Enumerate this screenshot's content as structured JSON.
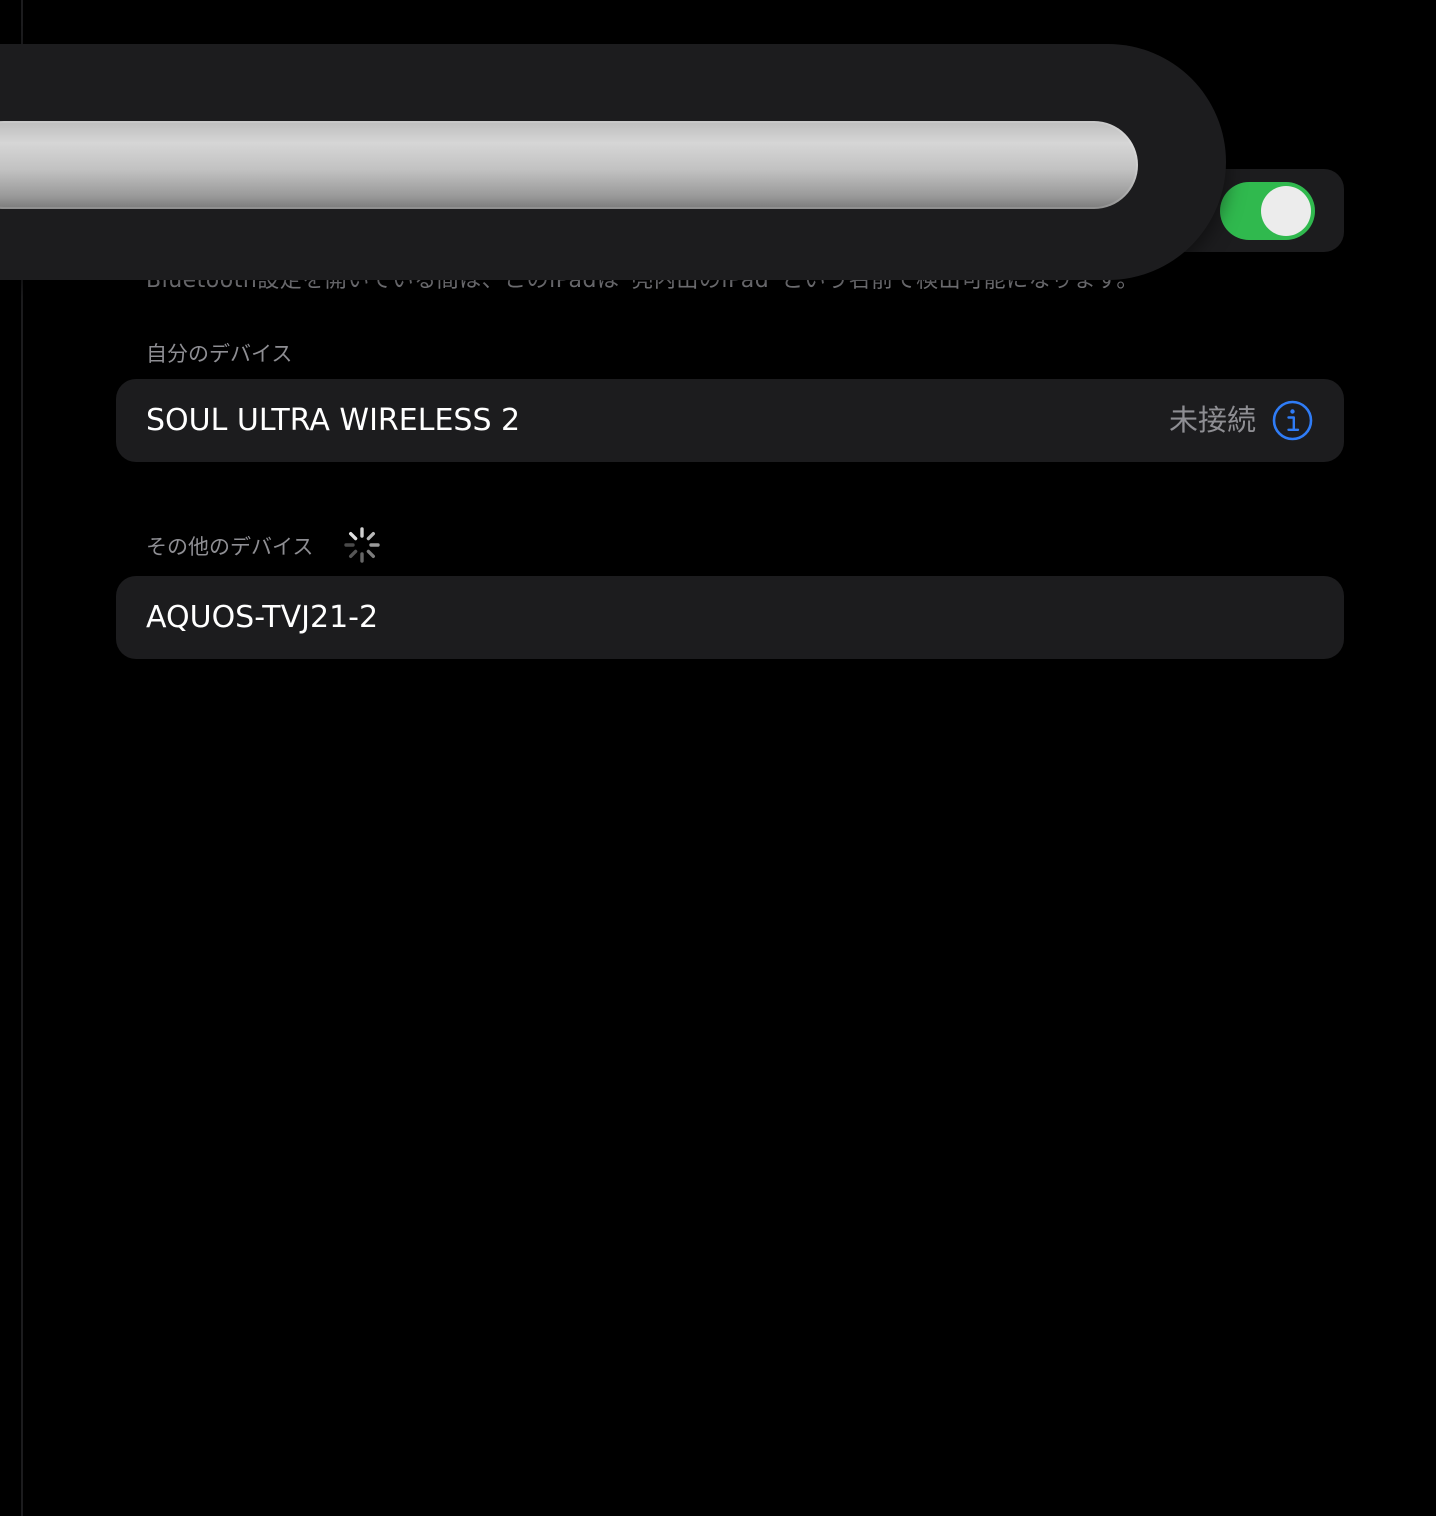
{
  "bluetooth": {
    "enabled": true,
    "footer_text": "Bluetooth設定を開いている間は、このiPadは“亮内出のiPad”という名前で検出可能になります。"
  },
  "my_devices": {
    "header": "自分のデバイス",
    "items": [
      {
        "name": "SOUL ULTRA WIRELESS 2",
        "status": "未接続"
      }
    ]
  },
  "other_devices": {
    "header": "その他のデバイス",
    "items": [
      {
        "name": "AQUOS-TVJ21-2"
      }
    ]
  },
  "colors": {
    "toggle_on": "#30b94e",
    "info_blue": "#2f7cf6",
    "row_bg": "#1c1c1e",
    "secondary_text": "#8e8e93"
  },
  "icons": {
    "info": "info-circle-icon",
    "spinner": "activity-spinner-icon"
  }
}
